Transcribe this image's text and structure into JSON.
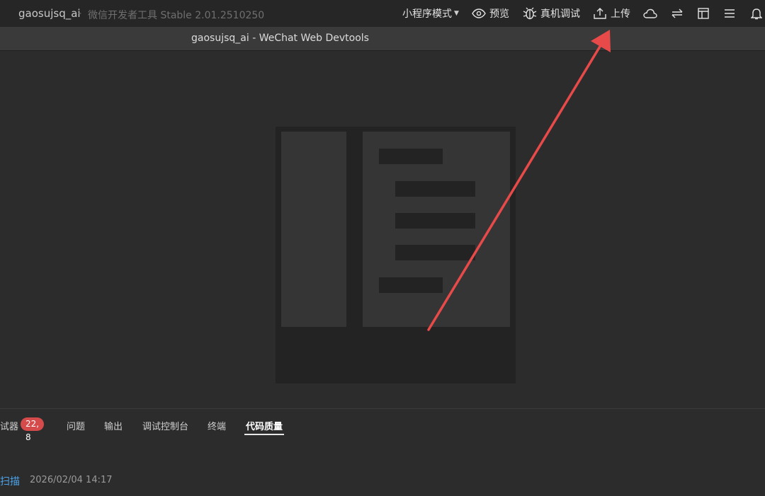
{
  "titlebar": {
    "project": "gaosujsq_ai",
    "separator": "-",
    "app_name": "微信开发者工具 Stable 2.01.2510250"
  },
  "toolbar": {
    "mode_label": "小程序模式",
    "preview_label": "预览",
    "device_debug_label": "真机调试",
    "upload_label": "上传",
    "icons": [
      "cloud-icon",
      "swap-icon",
      "layout-icon",
      "menu-icon",
      "bell-icon"
    ]
  },
  "subbar": {
    "window_title": "gaosujsq_ai - WeChat Web Devtools"
  },
  "panel": {
    "tabs": [
      {
        "label": "试器"
      },
      {
        "label": "问题"
      },
      {
        "label": "输出"
      },
      {
        "label": "调试控制台"
      },
      {
        "label": "终端"
      },
      {
        "label": "代码质量"
      }
    ],
    "badge": "22, 8",
    "active_tab": "代码质量",
    "scan_link": "扫描",
    "scan_time": "2026/02/04 14:17"
  },
  "colors": {
    "titlebar_bg": "#262626",
    "subbar_bg": "#3a3a3a",
    "main_bg": "#2c2c2c",
    "badge_bg": "#d54a4a",
    "link": "#4aa3ea",
    "annotation_arrow": "#e84a4a"
  }
}
